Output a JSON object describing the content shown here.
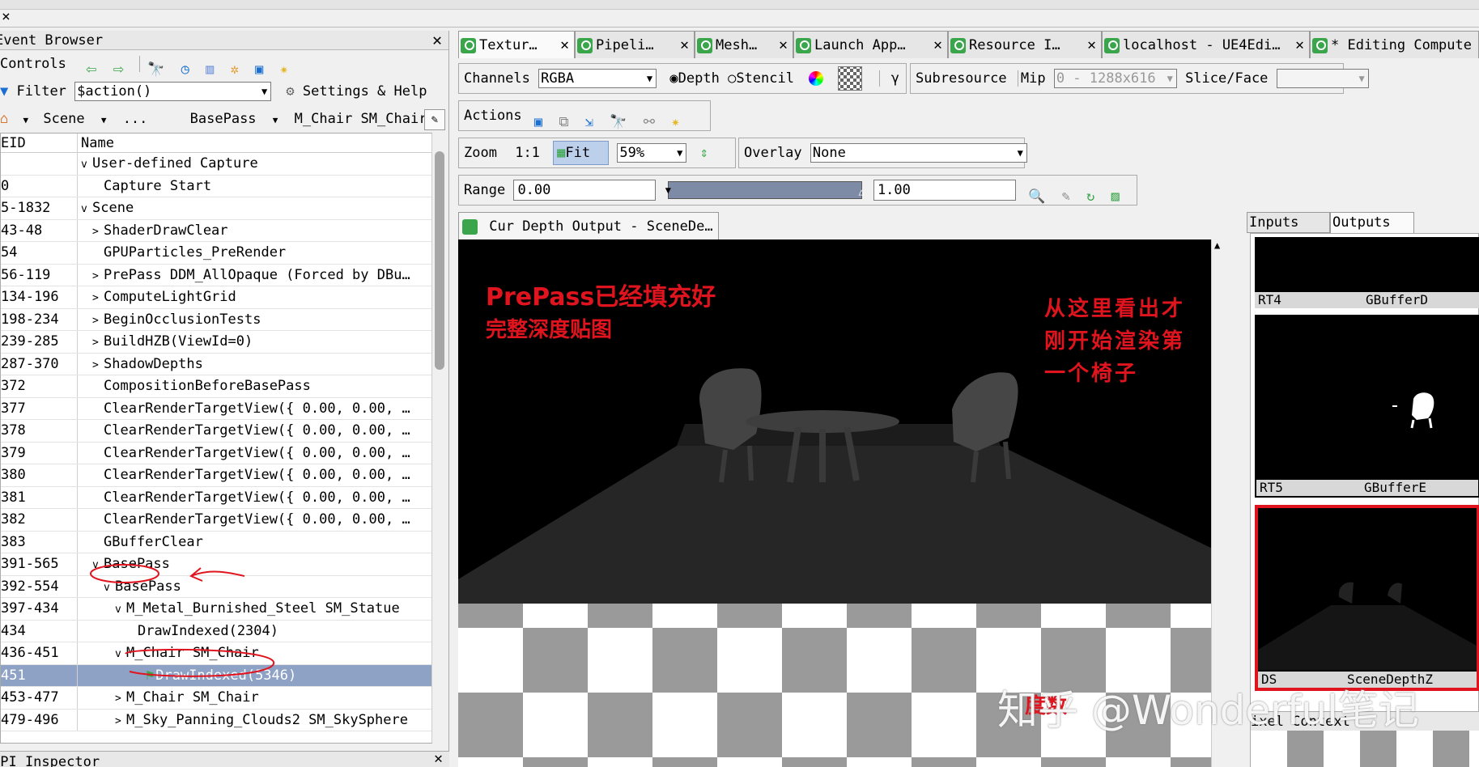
{
  "event_browser": {
    "title": "Event Browser",
    "controls_label": "Controls",
    "filter_label": "Filter",
    "filter_value": "$action()",
    "settings_label": "Settings & Help",
    "breadcrumb": [
      "Scene",
      "...",
      "BasePass",
      "M_Chair SM_Chair"
    ],
    "col_eid": "EID",
    "col_name": "Name",
    "rows": [
      {
        "eid": "",
        "name": "User-defined Capture",
        "expander": "v"
      },
      {
        "eid": "0",
        "name": "Capture Start",
        "expander": ""
      },
      {
        "eid": "5-1832",
        "name": "Scene",
        "expander": "v"
      },
      {
        "eid": "43-48",
        "name": "ShaderDrawClear",
        "expander": ">"
      },
      {
        "eid": "54",
        "name": "GPUParticles_PreRender",
        "expander": ""
      },
      {
        "eid": "56-119",
        "name": "PrePass DDM_AllOpaque (Forced by DBu…",
        "expander": ">"
      },
      {
        "eid": "134-196",
        "name": "ComputeLightGrid",
        "expander": ">"
      },
      {
        "eid": "198-234",
        "name": "BeginOcclusionTests",
        "expander": ">"
      },
      {
        "eid": "239-285",
        "name": "BuildHZB(ViewId=0)",
        "expander": ">"
      },
      {
        "eid": "287-370",
        "name": "ShadowDepths",
        "expander": ">"
      },
      {
        "eid": "372",
        "name": "CompositionBeforeBasePass",
        "expander": ""
      },
      {
        "eid": "377",
        "name": "ClearRenderTargetView({ 0.00, 0.00, …",
        "expander": ""
      },
      {
        "eid": "378",
        "name": "ClearRenderTargetView({ 0.00, 0.00, …",
        "expander": ""
      },
      {
        "eid": "379",
        "name": "ClearRenderTargetView({ 0.00, 0.00, …",
        "expander": ""
      },
      {
        "eid": "380",
        "name": "ClearRenderTargetView({ 0.00, 0.00, …",
        "expander": ""
      },
      {
        "eid": "381",
        "name": "ClearRenderTargetView({ 0.00, 0.00, …",
        "expander": ""
      },
      {
        "eid": "382",
        "name": "ClearRenderTargetView({ 0.00, 0.00, …",
        "expander": ""
      },
      {
        "eid": "383",
        "name": "GBufferClear",
        "expander": ""
      },
      {
        "eid": "391-565",
        "name": "BasePass",
        "expander": "v"
      },
      {
        "eid": "392-554",
        "name": "BasePass",
        "expander": "v"
      },
      {
        "eid": "397-434",
        "name": "M_Metal_Burnished_Steel SM_Statue",
        "expander": "v"
      },
      {
        "eid": "434",
        "name": "DrawIndexed(2304)",
        "expander": ""
      },
      {
        "eid": "436-451",
        "name": "M_Chair SM_Chair",
        "expander": "v"
      },
      {
        "eid": "451",
        "name": "DrawIndexed(5346)",
        "expander": ""
      },
      {
        "eid": "453-477",
        "name": "M_Chair SM_Chair",
        "expander": ">"
      },
      {
        "eid": "479-496",
        "name": "M_Sky_Panning_Clouds2 SM_SkySphere",
        "expander": ">"
      }
    ],
    "api_inspector_title": "API Inspector"
  },
  "tabs": [
    {
      "label": "Textur…"
    },
    {
      "label": "Pipeli…"
    },
    {
      "label": "Mesh…"
    },
    {
      "label": "Launch App…"
    },
    {
      "label": "Resource I…"
    },
    {
      "label": "localhost - UE4Edi…"
    },
    {
      "label": "* Editing Compute"
    }
  ],
  "texture_viewer": {
    "channels_label": "Channels",
    "channels_value": "RGBA",
    "depth_label": "Depth",
    "stencil_label": "Stencil",
    "gamma_label": "γ",
    "subresource_label": "Subresource",
    "mip_label": "Mip",
    "mip_value": "0 - 1288x616",
    "slice_label": "Slice/Face",
    "actions_label": "Actions",
    "zoom_label": "Zoom",
    "zoom_1_1": "1:1",
    "fit_label": "Fit",
    "zoom_value": "59%",
    "overlay_label": "Overlay",
    "overlay_value": "None",
    "range_label": "Range",
    "range_min": "0.00",
    "range_max": "1.00",
    "output_tab": "Cur Depth Output - SceneDe…",
    "io_tab_inputs": "Inputs",
    "io_tab_outputs": "Outputs",
    "thumbnails": [
      {
        "slot": "RT4",
        "name": "GBufferD"
      },
      {
        "slot": "RT5",
        "name": "GBufferE"
      },
      {
        "slot": "DS",
        "name": "SceneDepthZ"
      }
    ],
    "pixel_context_label": "ixel Context"
  },
  "annotations": {
    "note1_line1": "PrePass已经填充好",
    "note1_line2": "完整深度贴图",
    "note2_line1": "从这里看出才",
    "note2_line2": "刚开始渲染第",
    "note2_line3": "一个椅子",
    "note3": "度数",
    "watermark": "知乎 @Wonderful笔记"
  },
  "colors": {
    "accent_red": "#e0141e",
    "selected_row": "#8ea2c6",
    "tab_icon_green": "#3aa54a"
  }
}
